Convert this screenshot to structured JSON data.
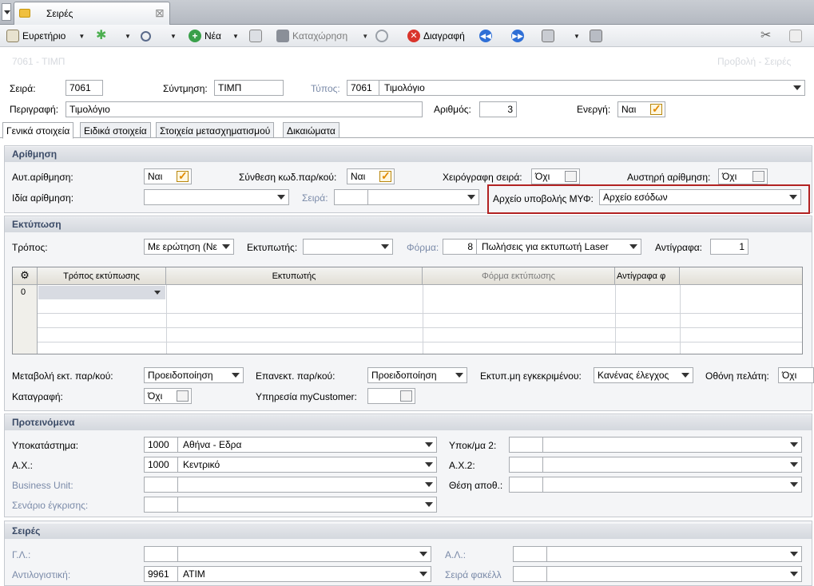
{
  "window": {
    "tab_title": "Σειρές"
  },
  "toolbar": {
    "index": "Ευρετήριο",
    "new": "Νέα",
    "save": "Καταχώρηση",
    "delete": "Διαγραφή"
  },
  "header": {
    "left": "7061 - ΤΙΜΠ",
    "right": "Προβολή - Σειρές"
  },
  "form": {
    "series_label": "Σειρά:",
    "series_value": "7061",
    "abbr_label": "Σύντμηση:",
    "abbr_value": "ΤΙΜΠ",
    "type_label": "Τύπος:",
    "type_code": "7061",
    "type_text": "Τιμολόγιο",
    "desc_label": "Περιγραφή:",
    "desc_value": "Τιμολόγιο",
    "number_label": "Αριθμός:",
    "number_value": "3",
    "active_label": "Ενεργή:",
    "active_value": "Ναι"
  },
  "tabs": [
    "Γενικά στοιχεία",
    "Ειδικά στοιχεία",
    "Στοιχεία μετασχηματισμού",
    "Δικαιώματα"
  ],
  "numbering": {
    "title": "Αρίθμηση",
    "auto_label": "Αυτ.αρίθμηση:",
    "auto_value": "Ναι",
    "compose_label": "Σύνθεση κωδ.παρ/κού:",
    "compose_value": "Ναι",
    "manual_label": "Χειρόγραφη σειρά:",
    "manual_value": "Όχι",
    "strict_label": "Αυστηρή αρίθμηση:",
    "strict_value": "Όχι",
    "same_label": "Ιδία αρίθμηση:",
    "series_label": "Σειρά:",
    "myf_label": "Αρχείο υποβολής ΜΥΦ:",
    "myf_value": "Αρχείο εσόδων"
  },
  "printing": {
    "title": "Εκτύπωση",
    "mode_label": "Τρόπος:",
    "mode_value": "Με ερώτηση (Νε",
    "printer_label": "Εκτυπωτής:",
    "form_label": "Φόρμα:",
    "form_code": "8",
    "form_text": "Πωλήσεις για εκτυπωτή Laser",
    "copies_label": "Αντίγραφα:",
    "copies_value": "1",
    "grid_cols": [
      "Τρόπος εκτύπωσης",
      "Εκτυπωτής",
      "Φόρμα εκτύπωσης",
      "Αντίγραφα φ"
    ],
    "grid_row0": "0",
    "change_label": "Μεταβολή εκτ. παρ/κού:",
    "change_value": "Προειδοποίηση",
    "reprint_label": "Επανεκτ. παρ/κού:",
    "reprint_value": "Προειδοποίηση",
    "unapproved_label": "Εκτυπ.μη εγκεκριμένου:",
    "unapproved_value": "Κανένας έλεγχος",
    "screen_label": "Οθόνη πελάτη:",
    "screen_value": "Όχι",
    "log_label": "Καταγραφή:",
    "log_value": "Όχι",
    "mycust_label": "Υπηρεσία myCustomer:"
  },
  "defaults": {
    "title": "Προτεινόμενα",
    "branch_label": "Υποκατάστημα:",
    "branch_code": "1000",
    "branch_text": "Αθήνα - Εδρα",
    "branch2_label": "Υποκ/μα 2:",
    "wh_label": "Α.Χ.:",
    "wh_code": "1000",
    "wh_text": "Κεντρικό",
    "wh2_label": "Α.Χ.2:",
    "bu_label": "Business Unit:",
    "pos_label": "Θέση αποθ.:",
    "scenario_label": "Σενάριο έγκρισης:"
  },
  "series": {
    "title": "Σειρές",
    "gl_label": "Γ.Λ.:",
    "al_label": "Α.Λ.:",
    "counter_label": "Αντιλογιστική:",
    "counter_code": "9961",
    "counter_text": "ΑΤΙΜ",
    "folder_label": "Σειρά φακέλλ"
  }
}
